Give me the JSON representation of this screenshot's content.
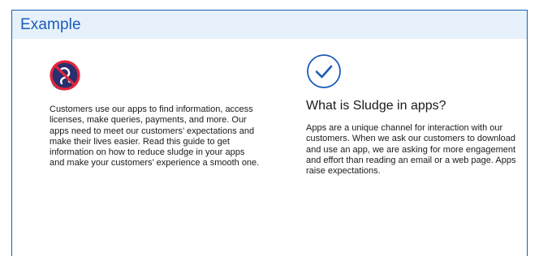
{
  "header": {
    "title": "Example"
  },
  "colors": {
    "accent": "#1b5db8",
    "header_bg": "#e6f1fb",
    "logo_navy": "#2a2f6e",
    "logo_red": "#e5243b"
  },
  "left": {
    "icon": "no-sludge-logo-icon",
    "body": "Customers use our apps to find information, access licenses, make queries, payments, and more. Our apps need to meet our customers’ expectations and make their lives easier. Read this guide to get information on how to reduce sludge in your apps and make your customers’ experience a smooth one."
  },
  "right": {
    "icon": "checkmark-circle-icon",
    "heading": "What is Sludge in apps?",
    "body": "Apps are a unique channel for interaction with our customers. When we ask our customers to download and use an app, we are asking for more engagement and effort than reading an email or a web page. Apps raise expectations."
  }
}
